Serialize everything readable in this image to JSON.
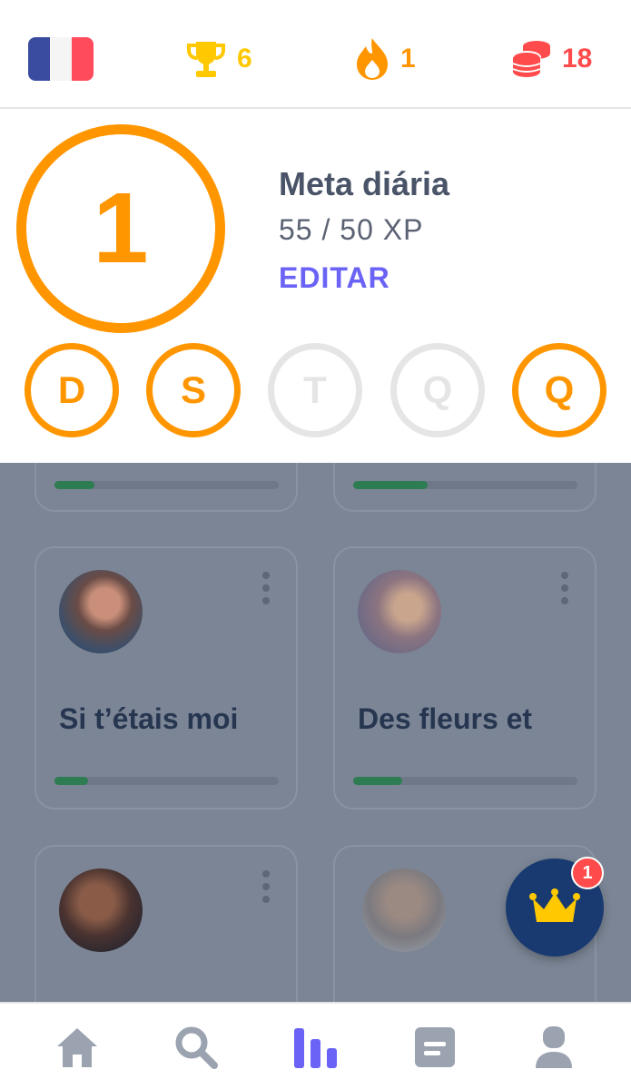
{
  "topbar": {
    "language": {
      "icon": "france-flag-icon",
      "colors": [
        "#3a4ca0",
        "#f5f5f5",
        "#ff4b5b"
      ]
    },
    "trophies": {
      "icon": "trophy-icon",
      "value": "6",
      "color": "#ffc800"
    },
    "streak": {
      "icon": "flame-icon",
      "value": "1",
      "color": "#ff9600"
    },
    "coins": {
      "icon": "coins-stack-icon",
      "value": "18",
      "color": "#ff4b4b"
    }
  },
  "daily_goal": {
    "ring_value": "1",
    "title": "Meta diária",
    "progress_text": "55 / 50 XP",
    "progress": {
      "current": 55,
      "target": 50,
      "unit": "XP"
    },
    "edit_label": "EDITAR",
    "days": [
      {
        "letter": "D",
        "done": true
      },
      {
        "letter": "S",
        "done": true
      },
      {
        "letter": "T",
        "done": false
      },
      {
        "letter": "Q",
        "done": false
      },
      {
        "letter": "Q",
        "done": true
      }
    ]
  },
  "songs": {
    "top_row_progress": [
      0.18,
      0.33
    ],
    "cards": [
      {
        "title": "Si t’étais moi",
        "progress": 0.15,
        "avatar": "avatar-portrait-woman"
      },
      {
        "title": "Des fleurs et",
        "progress": 0.22,
        "avatar": "avatar-album-cover"
      },
      {
        "title": "",
        "progress": 0,
        "avatar": "avatar-couple-dark"
      },
      {
        "title": "",
        "progress": 0,
        "avatar": "avatar-portrait-man"
      }
    ]
  },
  "fab": {
    "icon": "crown-icon",
    "badge_count": "1"
  },
  "bottom_nav": [
    {
      "icon": "home-icon",
      "active": false
    },
    {
      "icon": "search-icon",
      "active": false
    },
    {
      "icon": "stats-bars-icon",
      "active": true
    },
    {
      "icon": "news-icon",
      "active": false
    },
    {
      "icon": "profile-icon",
      "active": false
    }
  ],
  "colors": {
    "accent_orange": "#ff9600",
    "accent_purple": "#6b63f6",
    "progress_green": "#2e7d52",
    "overlay": "#7b8595"
  }
}
